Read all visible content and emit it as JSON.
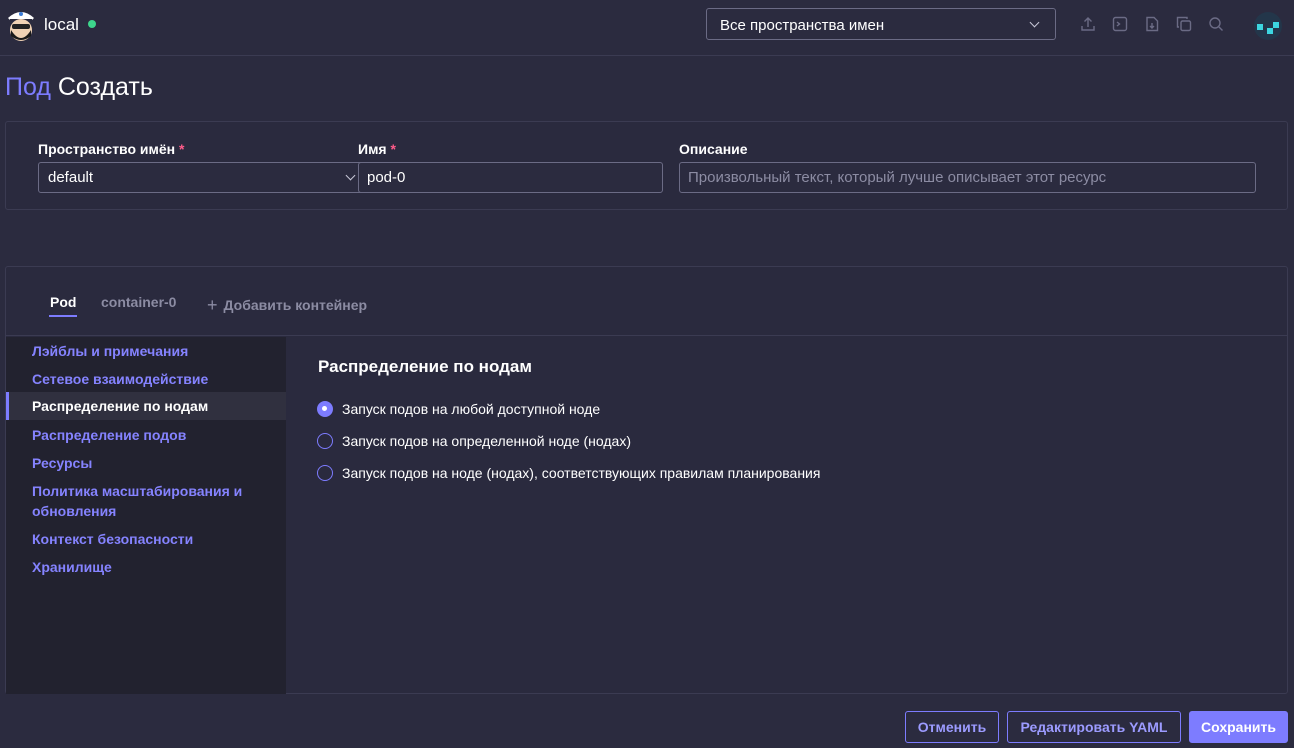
{
  "header": {
    "cluster_name": "local",
    "namespace_selector": "Все пространства имен",
    "toolbar_icons": [
      "import-yaml-icon",
      "kubectl-shell-icon",
      "kubeconfig-download-icon",
      "copy-kubeconfig-icon",
      "search-icon"
    ],
    "status_color": "#3dd68c"
  },
  "page": {
    "resource_type": "Под",
    "action": "Создать"
  },
  "form": {
    "namespace_label": "Пространство имён",
    "namespace_value": "default",
    "name_label": "Имя",
    "name_value": "pod-0",
    "description_label": "Описание",
    "description_placeholder": "Произвольный текст, который лучше описывает этот ресурс",
    "required_mark": "*"
  },
  "tabs": [
    {
      "label": "Pod",
      "active": true
    },
    {
      "label": "container-0",
      "active": false
    },
    {
      "label": "Добавить контейнер",
      "active": false
    }
  ],
  "sidenav": [
    {
      "label": "Лэйблы и примечания",
      "active": false
    },
    {
      "label": "Сетевое взаимодействие",
      "active": false
    },
    {
      "label": "Распределение по нодам",
      "active": true
    },
    {
      "label": "Распределение подов",
      "active": false
    },
    {
      "label": "Ресурсы",
      "active": false
    },
    {
      "label": "Политика масштабирования и обновления",
      "active": false
    },
    {
      "label": "Контекст безопасности",
      "active": false
    },
    {
      "label": "Хранилище",
      "active": false
    }
  ],
  "node_scheduling": {
    "title": "Распределение по нодам",
    "options": [
      {
        "label": "Запуск подов на любой доступной ноде",
        "selected": true
      },
      {
        "label": "Запуск подов на определенной ноде (нодах)",
        "selected": false
      },
      {
        "label": "Запуск подов на ноде (нодах), соответствующих правилам планирования",
        "selected": false
      }
    ]
  },
  "footer": {
    "cancel_label": "Отменить",
    "edit_yaml_label": "Редактировать YAML",
    "save_label": "Сохранить"
  },
  "colors": {
    "accent": "#7d7cff",
    "background": "#2b2b3f",
    "sidebar": "#22222f"
  }
}
